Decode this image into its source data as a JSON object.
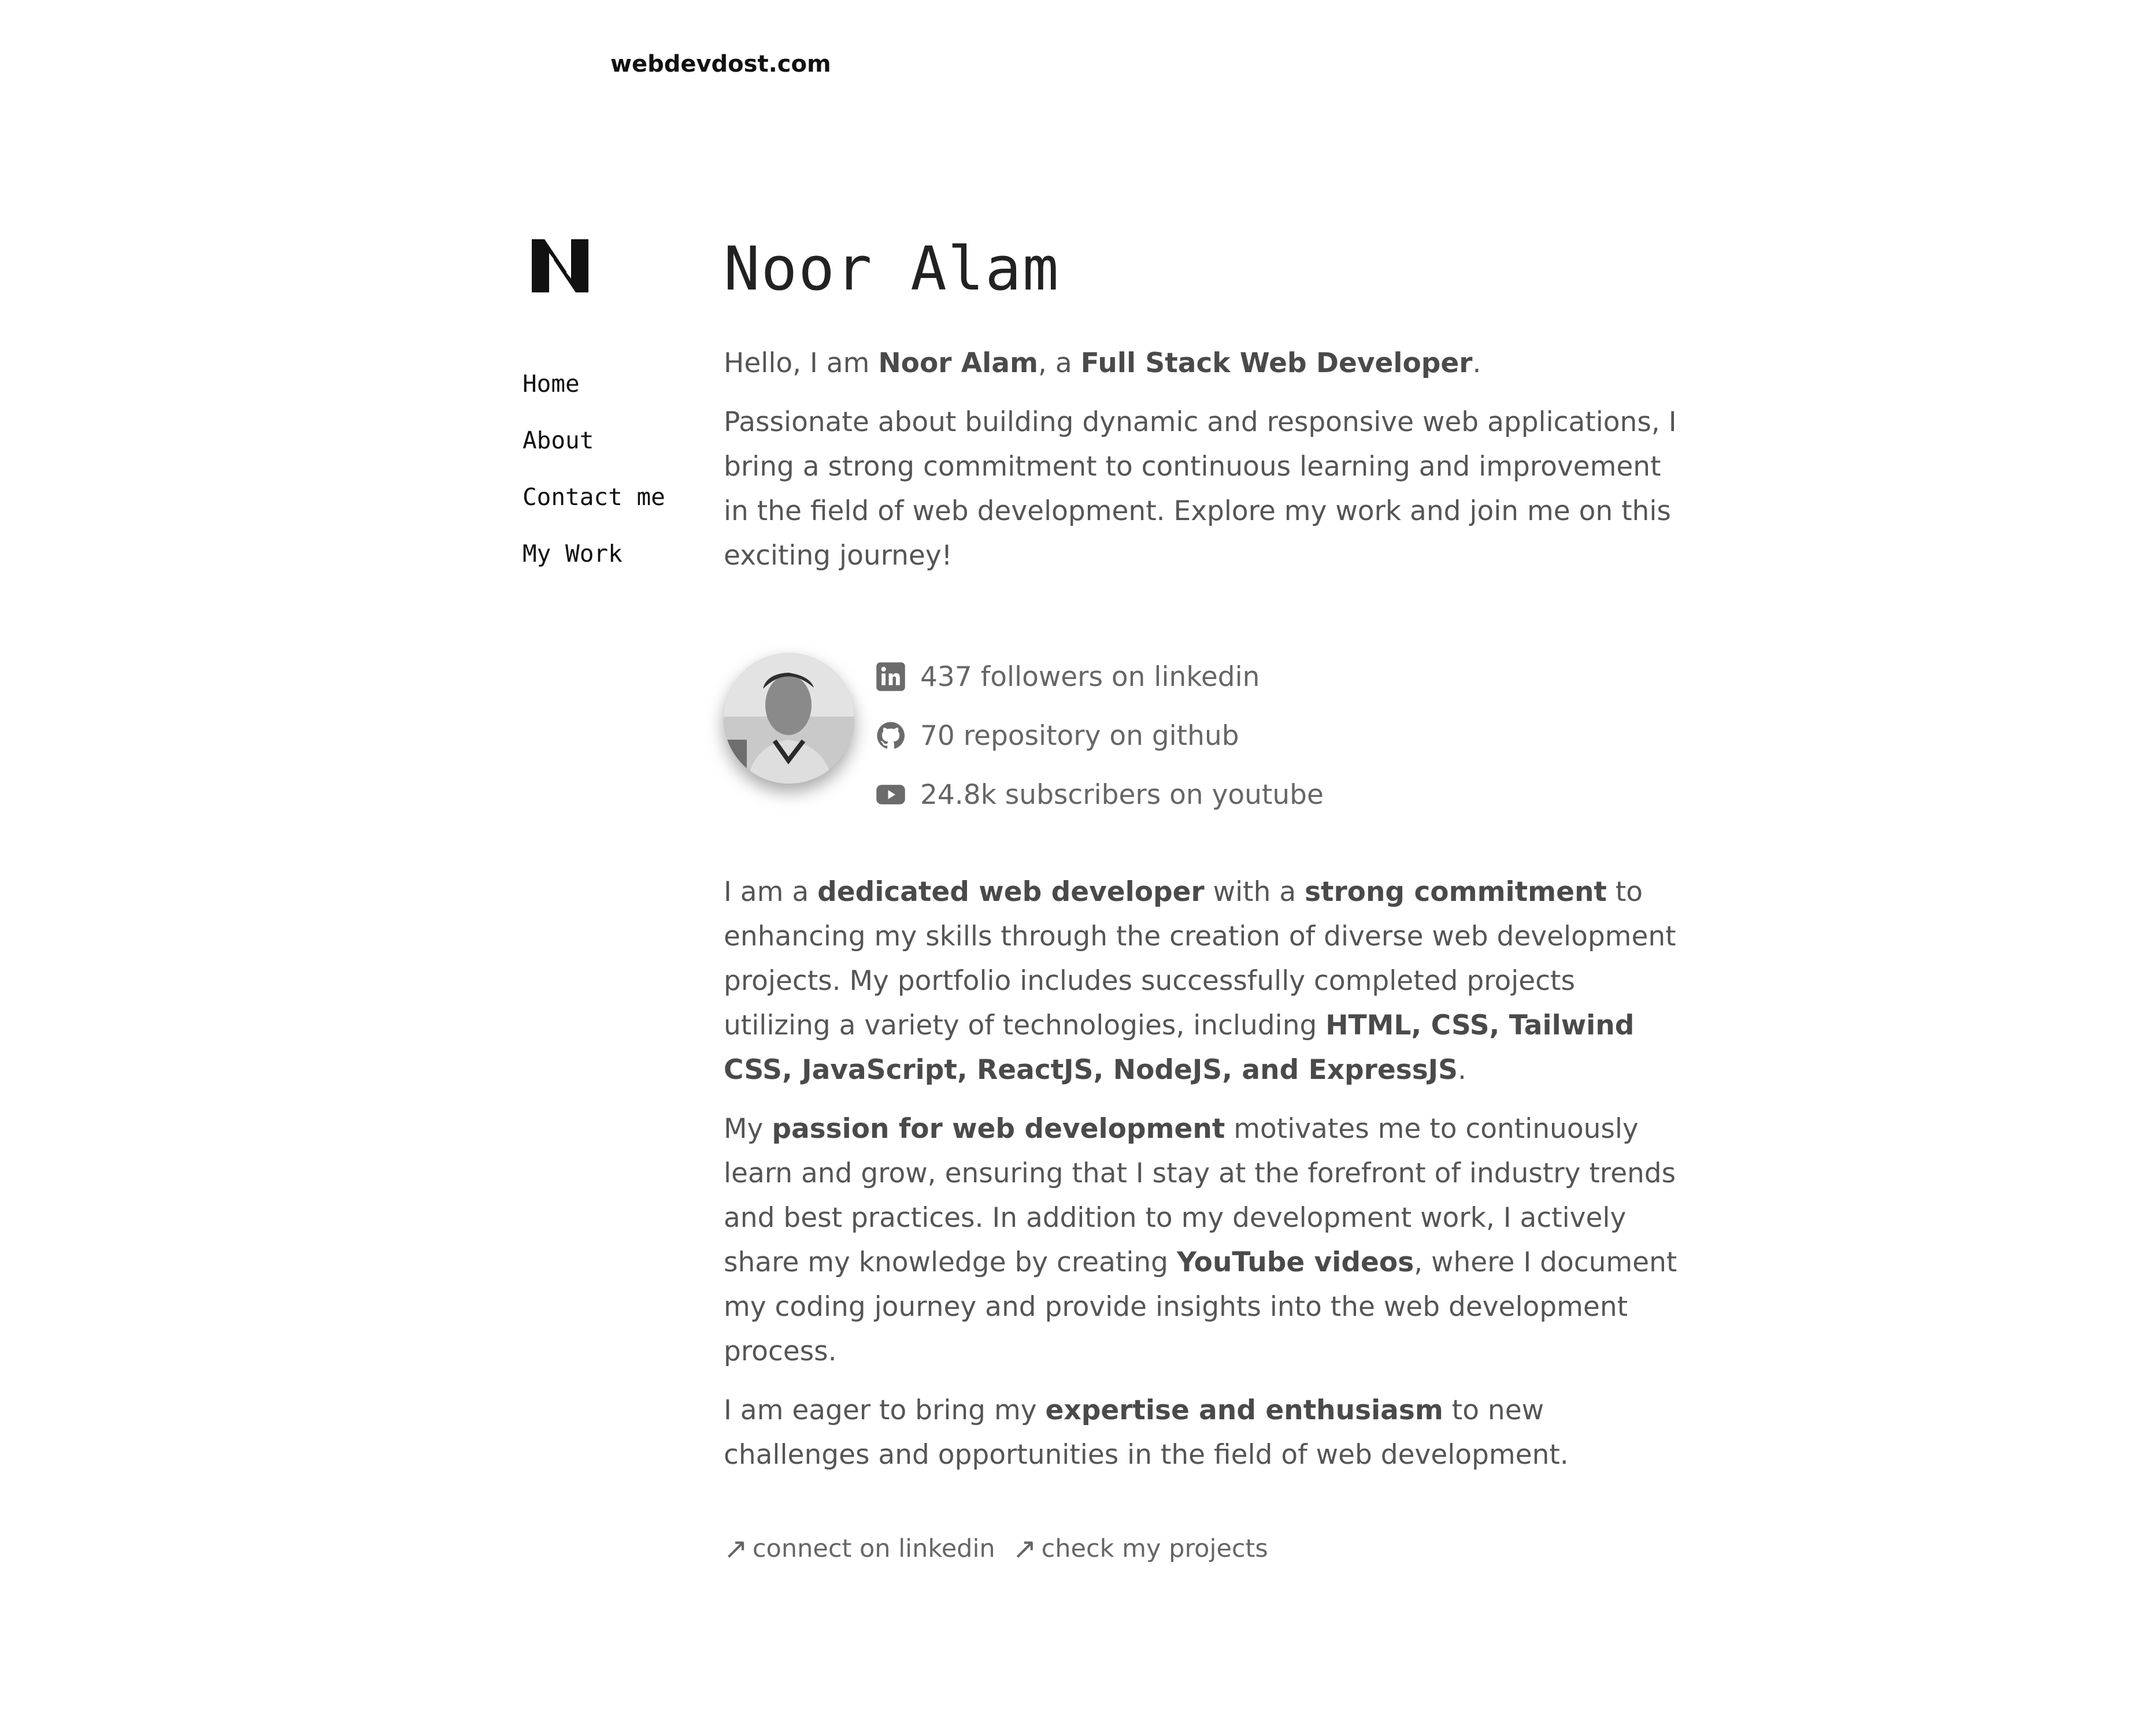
{
  "site": {
    "label": "webdevdost.com"
  },
  "sidebar": {
    "logo": "N",
    "nav": [
      {
        "label": "Home"
      },
      {
        "label": "About"
      },
      {
        "label": "Contact me"
      },
      {
        "label": "My Work"
      }
    ]
  },
  "main": {
    "title": "Noor Alam",
    "intro": {
      "t1": "Hello, I am ",
      "name": "Noor Alam",
      "t2": ", a ",
      "role": "Full Stack Web Developer",
      "t3": "."
    },
    "passion_text": "Passionate about building dynamic and responsive web applications, I bring a strong commitment to continuous learning and improvement in the field of web development. Explore my work and join me on this exciting journey!",
    "stats": [
      {
        "icon": "linkedin-icon",
        "text": "437 followers on linkedin"
      },
      {
        "icon": "github-icon",
        "text": "70 repository on github"
      },
      {
        "icon": "youtube-icon",
        "text": "24.8k subscribers on youtube"
      }
    ],
    "about1": {
      "t1": "I am a ",
      "b1": "dedicated web developer",
      "t2": " with a ",
      "b2": "strong commitment",
      "t3": " to enhancing my skills through the creation of diverse web development projects. My portfolio includes successfully completed projects utilizing a variety of technologies, including ",
      "b3": "HTML, CSS, Tailwind CSS, JavaScript, ReactJS, NodeJS, and ExpressJS",
      "t4": "."
    },
    "about2": {
      "t1": "My ",
      "b1": "passion for web development",
      "t2": " motivates me to continuously learn and grow, ensuring that I stay at the forefront of industry trends and best practices. In addition to my development work, I actively share my knowledge by creating ",
      "b2": "YouTube videos",
      "t3": ", where I document my coding journey and provide insights into the web development process."
    },
    "about3": {
      "t1": "I am eager to bring my ",
      "b1": "expertise and enthusiasm",
      "t2": " to new challenges and opportunities in the field of web development."
    },
    "links": [
      {
        "arrow": "↗",
        "label": "connect on linkedin"
      },
      {
        "arrow": "↗",
        "label": "check my projects"
      }
    ]
  },
  "colors": {
    "text": "#555555",
    "heading": "#222222",
    "nav": "#111111",
    "icon": "#6b6b6b"
  }
}
